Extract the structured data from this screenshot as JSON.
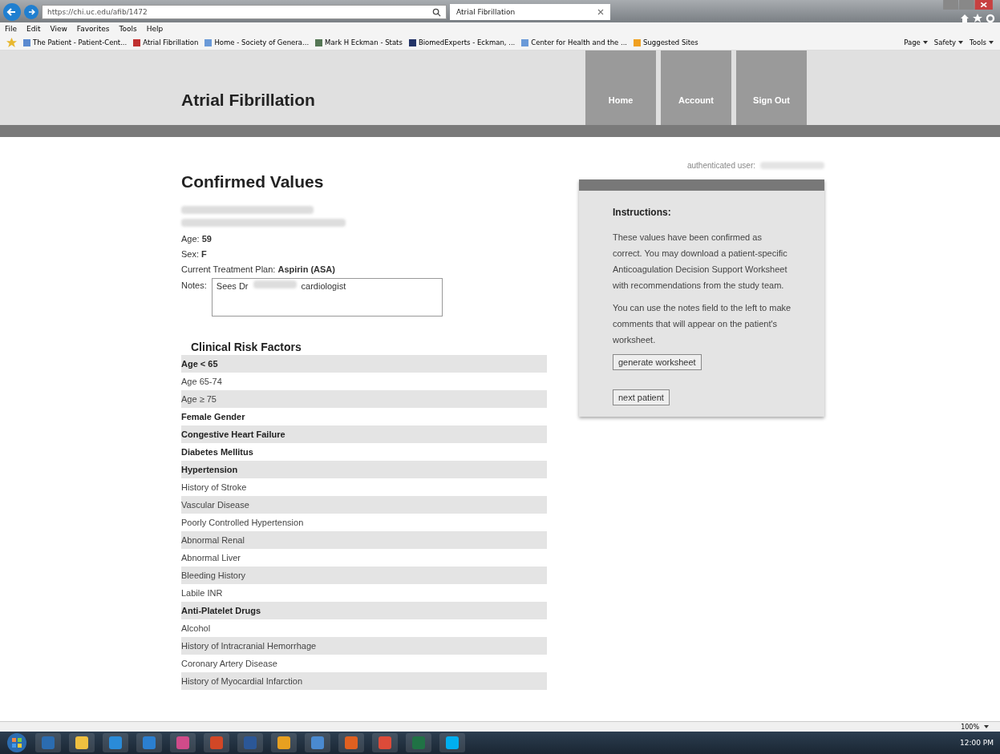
{
  "browser": {
    "url": "https://chi.uc.edu/afib/1472",
    "tab": {
      "title": "Atrial Fibrillation",
      "selected": true
    },
    "menu": [
      "File",
      "Edit",
      "View",
      "Favorites",
      "Tools",
      "Help"
    ],
    "favorites": [
      "The Patient - Patient-Cent...",
      "Atrial Fibrillation",
      "Home - Society of Genera...",
      "Mark H Eckman - Stats",
      "BiomedExperts - Eckman, ...",
      "Center for Health and the ...",
      "Suggested Sites"
    ],
    "commands": [
      "Page",
      "Safety",
      "Tools"
    ],
    "zoom": "100%"
  },
  "site": {
    "title": "Atrial Fibrillation",
    "nav": [
      "Home",
      "Account",
      "Sign Out"
    ]
  },
  "page": {
    "heading": "Confirmed Values",
    "fields": [
      {
        "label": "Age:",
        "value": "59"
      },
      {
        "label": "Sex:",
        "value": "F"
      },
      {
        "label": "Current Treatment Plan:",
        "value": "Aspirin (ASA)"
      }
    ],
    "notes": {
      "label": "Notes:",
      "value_start": "Sees Dr",
      "value_end": "cardiologist"
    },
    "risk_heading": "Clinical Risk Factors",
    "risk_factors": [
      {
        "name": "Age < 65",
        "present": true
      },
      {
        "name": "Age 65-74",
        "present": false
      },
      {
        "name": "Age ≥ 75",
        "present": false
      },
      {
        "name": "Female Gender",
        "present": true
      },
      {
        "name": "Congestive Heart Failure",
        "present": true
      },
      {
        "name": "Diabetes Mellitus",
        "present": true
      },
      {
        "name": "Hypertension",
        "present": true
      },
      {
        "name": "History of Stroke",
        "present": false
      },
      {
        "name": "Vascular Disease",
        "present": false
      },
      {
        "name": "Poorly Controlled Hypertension",
        "present": false
      },
      {
        "name": "Abnormal Renal",
        "present": false
      },
      {
        "name": "Abnormal Liver",
        "present": false
      },
      {
        "name": "Bleeding History",
        "present": false
      },
      {
        "name": "Labile INR",
        "present": false
      },
      {
        "name": "Anti-Platelet Drugs",
        "present": true
      },
      {
        "name": "Alcohol",
        "present": false
      },
      {
        "name": "History of Intracranial Hemorrhage",
        "present": false
      },
      {
        "name": "Coronary Artery Disease",
        "present": false
      },
      {
        "name": "History of Myocardial Infarction",
        "present": false
      }
    ]
  },
  "panel": {
    "auth_label": "authenticated user:",
    "heading": "Instructions:",
    "paragraphs": [
      "These values have been confirmed as correct. You may download a patient-specific Anticoagulation Decision Support Worksheet with recommendations from the study team.",
      "You can use the notes field to the left to make comments that will appear on the patient's worksheet."
    ],
    "buttons": [
      "generate worksheet",
      "next patient"
    ]
  },
  "taskbar": {
    "clock": "12:00 PM"
  }
}
